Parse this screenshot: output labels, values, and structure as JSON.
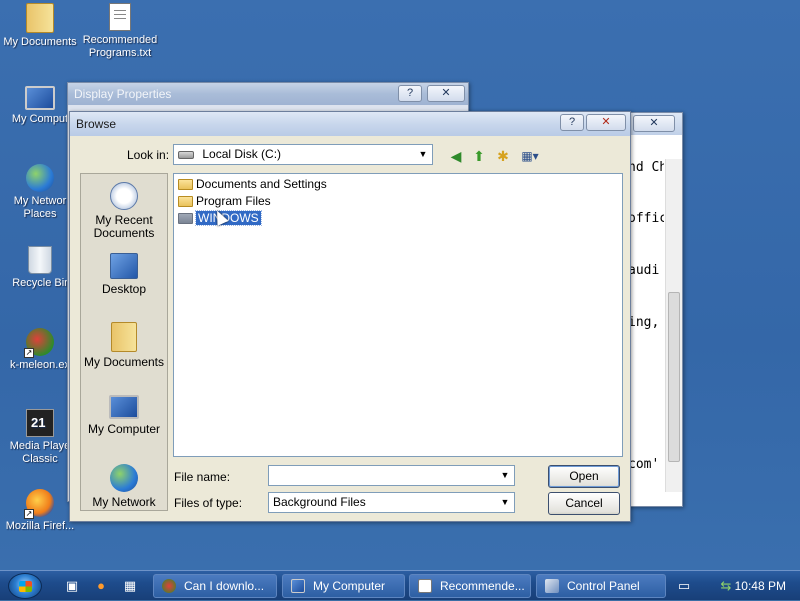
{
  "desktop": {
    "icons": [
      {
        "label": "My Documents"
      },
      {
        "label": "Recommended Programs.txt"
      },
      {
        "label": "My Comput"
      },
      {
        "label": "My Networ Places"
      },
      {
        "label": "Recycle Bir"
      },
      {
        "label": "k-meleon.ex"
      },
      {
        "label": "Media Playe Classic"
      },
      {
        "label": "Mozilla Firef..."
      }
    ]
  },
  "display_properties": {
    "title": "Display Properties",
    "help_label": "?",
    "close_label": "✕"
  },
  "notepad": {
    "close_label": "✕",
    "lines": [
      "nd Ch",
      "offic",
      "audi",
      "ing,",
      "com'"
    ]
  },
  "browse": {
    "title": "Browse",
    "help_label": "?",
    "close_label": "✕",
    "look_in_label": "Look in:",
    "look_in_value": "Local Disk (C:)",
    "nav": {
      "back": "◀",
      "up": "⬆",
      "new_folder": "✱",
      "views": "▦▾"
    },
    "places": [
      {
        "label": "My Recent Documents"
      },
      {
        "label": "Desktop"
      },
      {
        "label": "My Documents"
      },
      {
        "label": "My Computer"
      },
      {
        "label": "My Network"
      }
    ],
    "files": [
      {
        "name": "Documents and Settings",
        "selected": false
      },
      {
        "name": "Program Files",
        "selected": false
      },
      {
        "name": "WINDOWS",
        "selected": true
      }
    ],
    "file_name_label": "File name:",
    "file_name_value": "",
    "file_type_label": "Files of type:",
    "file_type_value": "Background Files",
    "open_label": "Open",
    "cancel_label": "Cancel"
  },
  "taskbar": {
    "items": [
      {
        "label": "Can I downlo..."
      },
      {
        "label": "My Computer"
      },
      {
        "label": "Recommende..."
      },
      {
        "label": "Control Panel"
      }
    ],
    "clock": "10:48 PM"
  },
  "colors": {
    "desktop": "#3a6ea5",
    "selection": "#316ac5",
    "taskbar": "#1e4c8c"
  }
}
